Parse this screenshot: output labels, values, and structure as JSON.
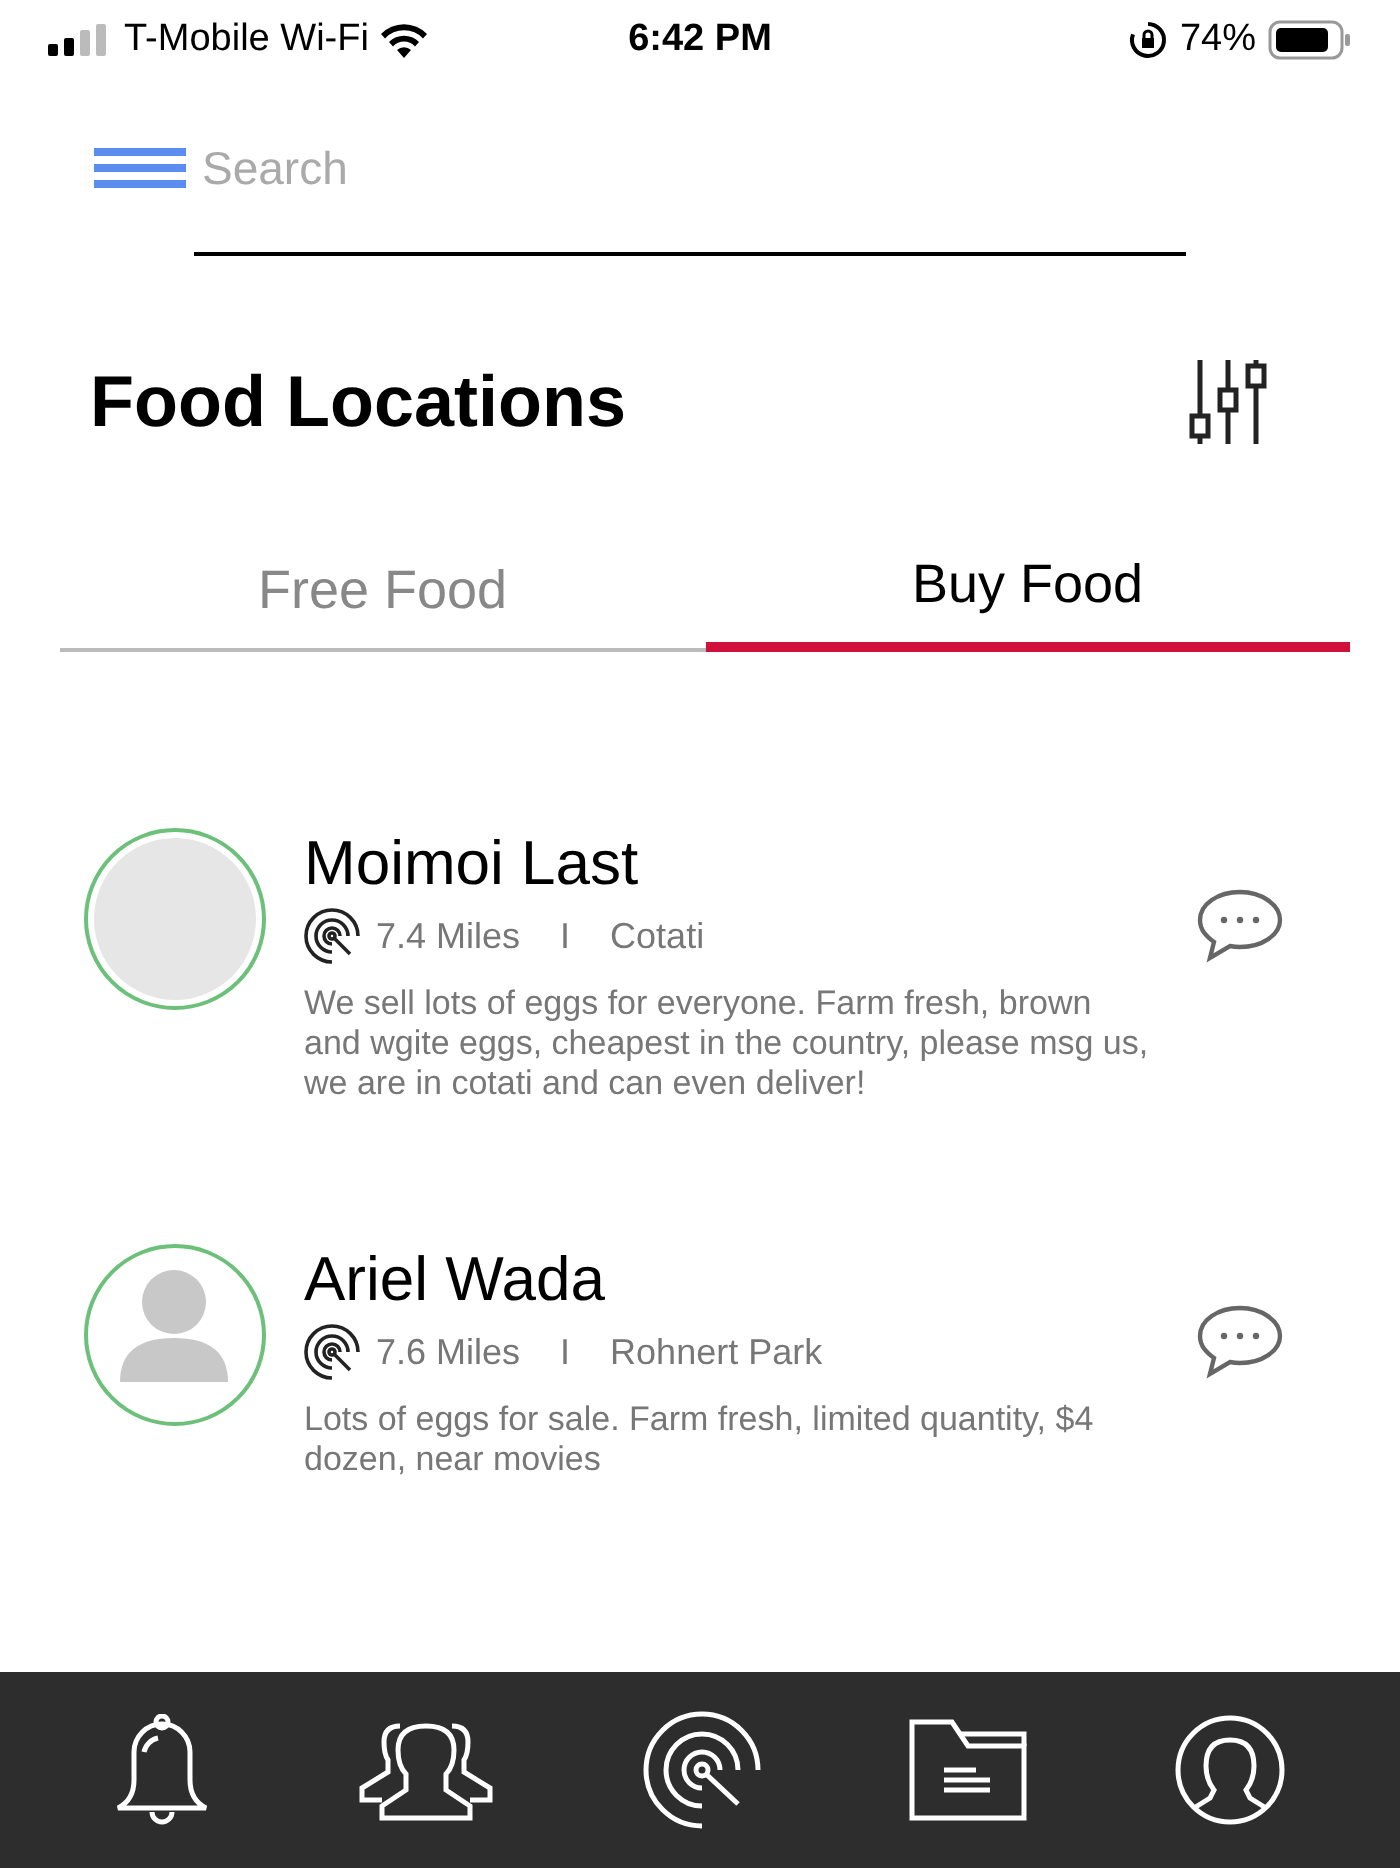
{
  "status_bar": {
    "carrier": "T-Mobile Wi-Fi",
    "time": "6:42 PM",
    "battery": "74%"
  },
  "search": {
    "placeholder": "Search"
  },
  "title": "Food Locations",
  "tabs": [
    {
      "label": "Free Food",
      "selected": false
    },
    {
      "label": "Buy Food",
      "selected": true
    }
  ],
  "listings": [
    {
      "name": "Moimoi Last",
      "avatar": {
        "kind": "blank"
      },
      "distance": "7.4 Miles",
      "separator": "I",
      "city": "Cotati",
      "description": "We sell lots of eggs for everyone. Farm fresh, brown and wgite eggs, cheapest in the country, please msg us, we are in cotati and can even deliver!"
    },
    {
      "name": "Ariel Wada",
      "avatar": {
        "kind": "silhouette"
      },
      "distance": "7.6 Miles",
      "separator": "I",
      "city": "Rohnert Park",
      "description": "Lots of eggs for sale. Farm fresh, limited quantity, $4 dozen, near movies"
    }
  ]
}
